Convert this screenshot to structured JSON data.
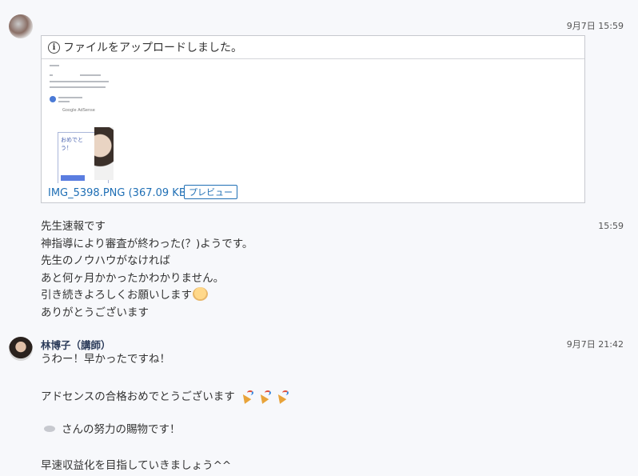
{
  "message1": {
    "timestamp": "9月7日 15:59",
    "upload_notice": "ファイルをアップロードしました。",
    "info_icon": "info-icon",
    "file_name": "IMG_5398.PNG (367.09 KB)",
    "preview_label": "プレビュー"
  },
  "message2": {
    "timestamp": "15:59",
    "lines": [
      "先生速報です",
      "神指導により審査が終わった(？)ようです。",
      "先生のノウハウがなければ",
      "あと何ヶ月かかったかわかりません。",
      "引き続きよろしくお願いします",
      "ありがとうございます"
    ],
    "emoji": "bowing-face-emoji"
  },
  "message3": {
    "sender": "林博子（講師）",
    "timestamp": "9月7日 21:42",
    "line1": "うわー！早かったですね！",
    "line2": "アドセンスの合格おめでとうございます",
    "party_emoji": "party-popper-emoji",
    "line3": "さんの努力の賜物です！",
    "line4": "早速収益化を目指していきましょう^^"
  }
}
